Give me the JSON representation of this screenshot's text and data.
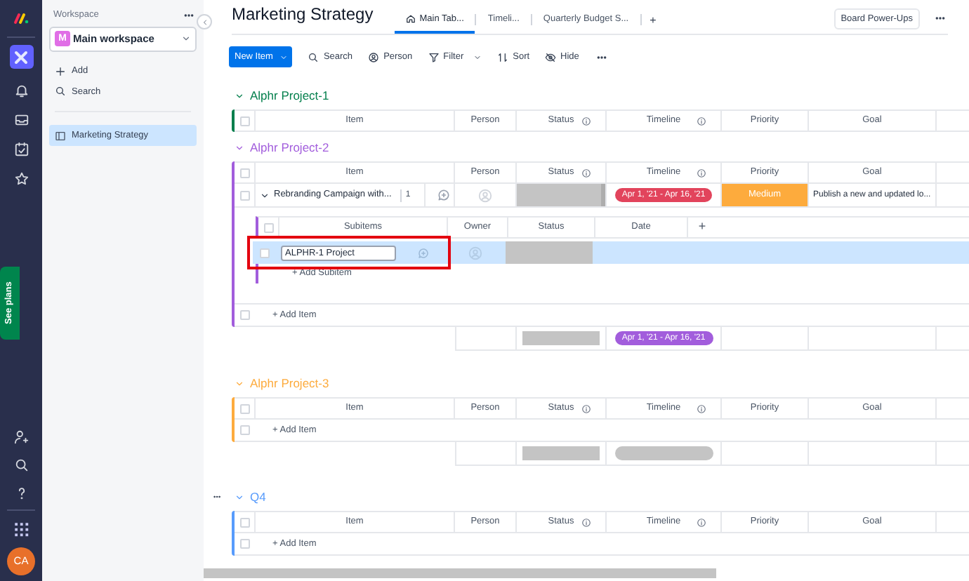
{
  "nav": {
    "see_plans": "See plans",
    "avatar": "CA"
  },
  "workspace": {
    "label": "Workspace",
    "badge": "M",
    "name": "Main workspace"
  },
  "sidebar_actions": [
    {
      "label": "Add",
      "kind": "add"
    },
    {
      "label": "Search",
      "kind": "search"
    }
  ],
  "boards": [
    {
      "label": "Marketing Strategy",
      "selected": true
    }
  ],
  "board": {
    "title": "Marketing Strategy",
    "tabs": [
      {
        "label": "Main Tab...",
        "selected": true
      },
      {
        "label": "Timeli...",
        "selected": false
      },
      {
        "label": "Quarterly Budget S...",
        "selected": false
      }
    ],
    "add_tab": "+",
    "power_ups": "Board Power-Ups"
  },
  "toolbar": {
    "new_item": "New Item",
    "actions": [
      {
        "label": "Search",
        "kind": "search"
      },
      {
        "label": "Person",
        "kind": "person"
      },
      {
        "label": "Filter",
        "kind": "filter"
      },
      {
        "label": "Sort",
        "kind": "sort"
      },
      {
        "label": "Hide",
        "kind": "hide"
      }
    ]
  },
  "groups": [
    {
      "name": "Alphr Project-1",
      "color": "#037f4c",
      "menu": false,
      "header_checked": false,
      "columns": [
        {
          "label": "Item",
          "info": false
        },
        {
          "label": "Person",
          "info": false
        },
        {
          "label": "Status",
          "info": true
        },
        {
          "label": "Timeline",
          "info": true
        },
        {
          "label": "Priority",
          "info": false
        },
        {
          "label": "Goal",
          "info": false
        }
      ]
    },
    {
      "name": "Alphr Project-2",
      "color": "#a25ddc",
      "menu": false,
      "header_checked": false,
      "add_row_checked": false,
      "columns": [
        {
          "label": "Item",
          "info": false
        },
        {
          "label": "Person",
          "info": false
        },
        {
          "label": "Status",
          "info": true
        },
        {
          "label": "Timeline",
          "info": true
        },
        {
          "label": "Priority",
          "info": false
        },
        {
          "label": "Goal",
          "info": false
        }
      ],
      "rows": [
        {
          "checked": false,
          "item": "Rebranding Campaign with...",
          "subitem_count": "1",
          "expanded": true,
          "timeline": {
            "text": "Apr 1, '21 - Apr 16, '21",
            "color": "#e2445c"
          },
          "priority": {
            "text": "Medium",
            "color": "#fdab3d"
          },
          "goal": "Publish a new and updated lo...",
          "subitems": {
            "header_checked": false,
            "columns": [
              "Subitems",
              "Owner",
              "Status",
              "Date"
            ],
            "add_column": "+",
            "rows": [
              {
                "name": "ALPHR-1 Project",
                "checked": false,
                "selected": true,
                "highlighted": true
              }
            ],
            "add": "+ Add Subitem"
          }
        }
      ],
      "add_item": "+ Add Item",
      "summary": {
        "timeline": {
          "text": "Apr 1, '21 - Apr 16, '21",
          "color": "#a25ddc"
        }
      }
    },
    {
      "name": "Alphr Project-3",
      "color": "#fdab3d",
      "menu": false,
      "header_checked": false,
      "add_row_checked": false,
      "columns": [
        {
          "label": "Item",
          "info": false
        },
        {
          "label": "Person",
          "info": false
        },
        {
          "label": "Status",
          "info": true
        },
        {
          "label": "Timeline",
          "info": true
        },
        {
          "label": "Priority",
          "info": false
        },
        {
          "label": "Goal",
          "info": false
        }
      ],
      "add_item": "+ Add Item",
      "summary": {
        "timeline": {
          "color": "#c4c4c4"
        }
      }
    },
    {
      "name": "Q4",
      "color": "#579bfc",
      "menu": true,
      "header_checked": false,
      "add_row_checked": false,
      "columns": [
        {
          "label": "Item",
          "info": false
        },
        {
          "label": "Person",
          "info": false
        },
        {
          "label": "Status",
          "info": true
        },
        {
          "label": "Timeline",
          "info": true
        },
        {
          "label": "Priority",
          "info": false
        },
        {
          "label": "Goal",
          "info": false
        }
      ],
      "add_item": "+ Add Item"
    }
  ]
}
